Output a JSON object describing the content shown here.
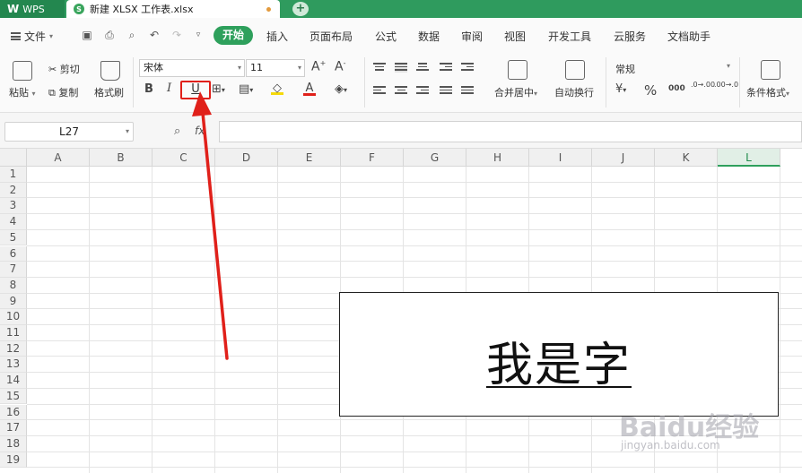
{
  "titlebar": {
    "wps_label": "WPS",
    "doc_tab_label": "新建 XLSX 工作表.xlsx",
    "new_tab_label": "+"
  },
  "menu": {
    "file": "文件",
    "start": "开始",
    "items": [
      "插入",
      "页面布局",
      "公式",
      "数据",
      "审阅",
      "视图",
      "开发工具",
      "云服务",
      "文档助手"
    ]
  },
  "ribbon": {
    "paste": "粘贴",
    "cut": "剪切",
    "copy": "复制",
    "format_painter": "格式刷",
    "font_name": "宋体",
    "font_size": "11",
    "bold": "B",
    "italic": "I",
    "underline": "U",
    "merge_center": "合并居中",
    "wrap_text": "自动换行",
    "number_format": "常规",
    "percent": "%",
    "thousands": "000",
    "increase_decimal": ".0→.00",
    "decrease_decimal": ".00→.0",
    "conditional_format": "条件格式"
  },
  "formula_bar": {
    "name_box": "L27",
    "fx": "fx"
  },
  "sheet": {
    "columns": [
      "A",
      "B",
      "C",
      "D",
      "E",
      "F",
      "G",
      "H",
      "I",
      "J",
      "K",
      "L"
    ],
    "selected_column": "L",
    "rows": [
      "1",
      "2",
      "3",
      "4",
      "5",
      "6",
      "7",
      "8",
      "9",
      "10",
      "11",
      "12",
      "13",
      "14",
      "15",
      "16",
      "17",
      "18",
      "19"
    ]
  },
  "textbox": {
    "text": "我是字"
  },
  "watermark": {
    "brand": "Baidu经验",
    "url": "jingyan.baidu.com"
  },
  "colors": {
    "accent_green": "#2ea05c",
    "annotation_red": "#e0201a"
  }
}
